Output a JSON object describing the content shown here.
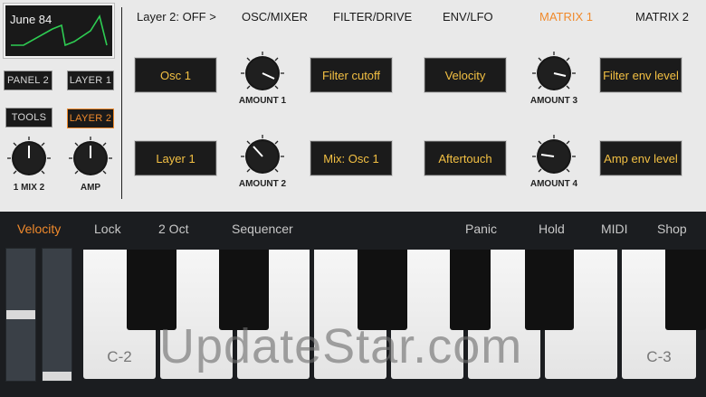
{
  "screen": {
    "title": "June 84"
  },
  "sidebar": {
    "panel2": "PANEL 2",
    "layer1": "LAYER 1",
    "tools": "TOOLS",
    "layer2": "LAYER 2",
    "knob_mix": "1 MIX 2",
    "knob_amp": "AMP"
  },
  "tabs": [
    "Layer 2: OFF >",
    "OSC/MIXER",
    "FILTER/DRIVE",
    "ENV/LFO",
    "MATRIX 1",
    "MATRIX 2"
  ],
  "active_tab": "MATRIX 1",
  "matrix": {
    "row1": {
      "source_a": "Osc 1",
      "amount_a": "AMOUNT 1",
      "dest_a": "Filter cutoff",
      "source_b": "Velocity",
      "amount_b": "AMOUNT 3",
      "dest_b": "Filter env level"
    },
    "row2": {
      "source_a": "Layer 1",
      "amount_a": "AMOUNT 2",
      "dest_a": "Mix: Osc 1",
      "source_b": "Aftertouch",
      "amount_b": "AMOUNT 4",
      "dest_b": "Amp env level"
    }
  },
  "toolbar": {
    "velocity": "Velocity",
    "lock": "Lock",
    "octave": "2 Oct",
    "sequencer": "Sequencer",
    "panic": "Panic",
    "hold": "Hold",
    "midi": "MIDI",
    "shop": "Shop"
  },
  "keyboard": {
    "label_left": "C-2",
    "label_right": "C-3"
  },
  "watermark": "UpdateStar.com",
  "colors": {
    "accent": "#f08a2c",
    "slot_text": "#f3c043",
    "panel": "#e9e9e9",
    "background": "#1b1d20"
  },
  "icons": [
    "knob-icon"
  ]
}
